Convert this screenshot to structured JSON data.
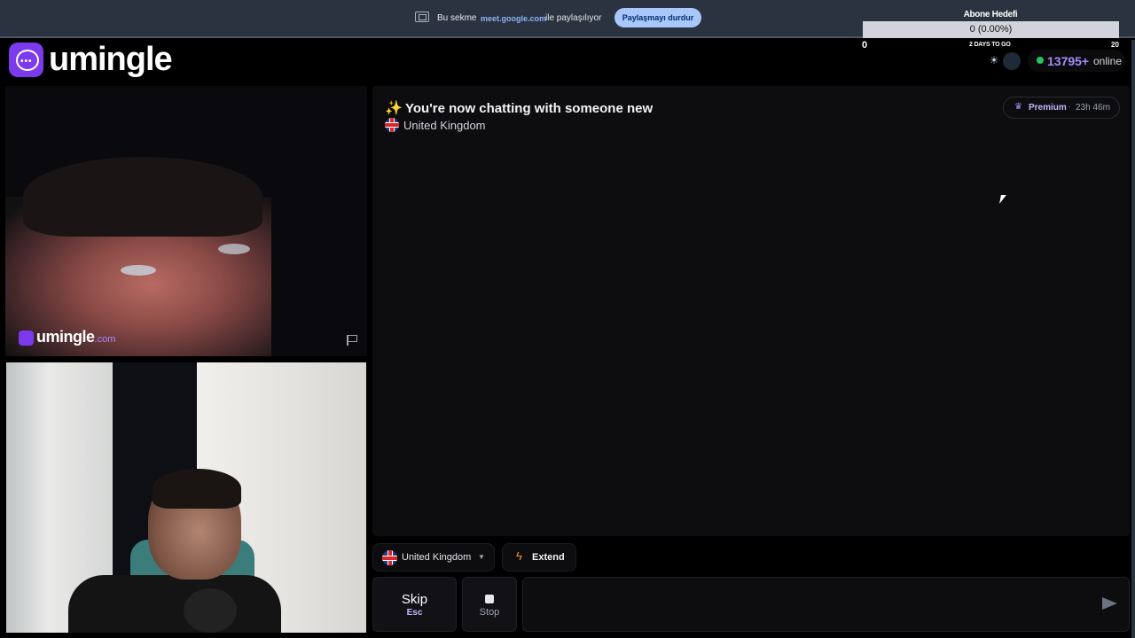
{
  "sharebar": {
    "text_before": "Bu sekme",
    "domain": "meet.google.com",
    "text_after": "ile paylaşılıyor",
    "stop_button": "Paylaşmayı durdur"
  },
  "goal": {
    "title": "Abone Hedefi",
    "progress": "0 (0.00%)",
    "min": "0",
    "days_left": "2 DAYS TO GO",
    "max": "20"
  },
  "header": {
    "logo": "umingle",
    "online_count": "13795+",
    "online_label": "online"
  },
  "stranger_video": {
    "watermark": "umingle",
    "watermark_suffix": ".com"
  },
  "chat": {
    "headline": "You're now chatting with someone new",
    "country": "United Kingdom",
    "premium_label": "Premium",
    "premium_sep": "·",
    "premium_timer": "23h 46m"
  },
  "controls": {
    "country_select": "United Kingdom",
    "extend_label": "Extend",
    "skip_label": "Skip",
    "skip_key": "Esc",
    "stop_label": "Stop",
    "message_placeholder": ""
  },
  "colors": {
    "brand": "#7c3aed",
    "online": "#22c55e",
    "accent_text": "#a78bfa",
    "share_button": "#a8c7fa"
  },
  "icons": [
    "share-tab-icon",
    "chat-logo-icon",
    "sun-icon",
    "online-dot-icon",
    "report-flag-icon",
    "sparkle-icon",
    "uk-flag-icon",
    "crown-icon",
    "caret-down-icon",
    "bolt-icon",
    "stop-icon",
    "send-icon"
  ]
}
